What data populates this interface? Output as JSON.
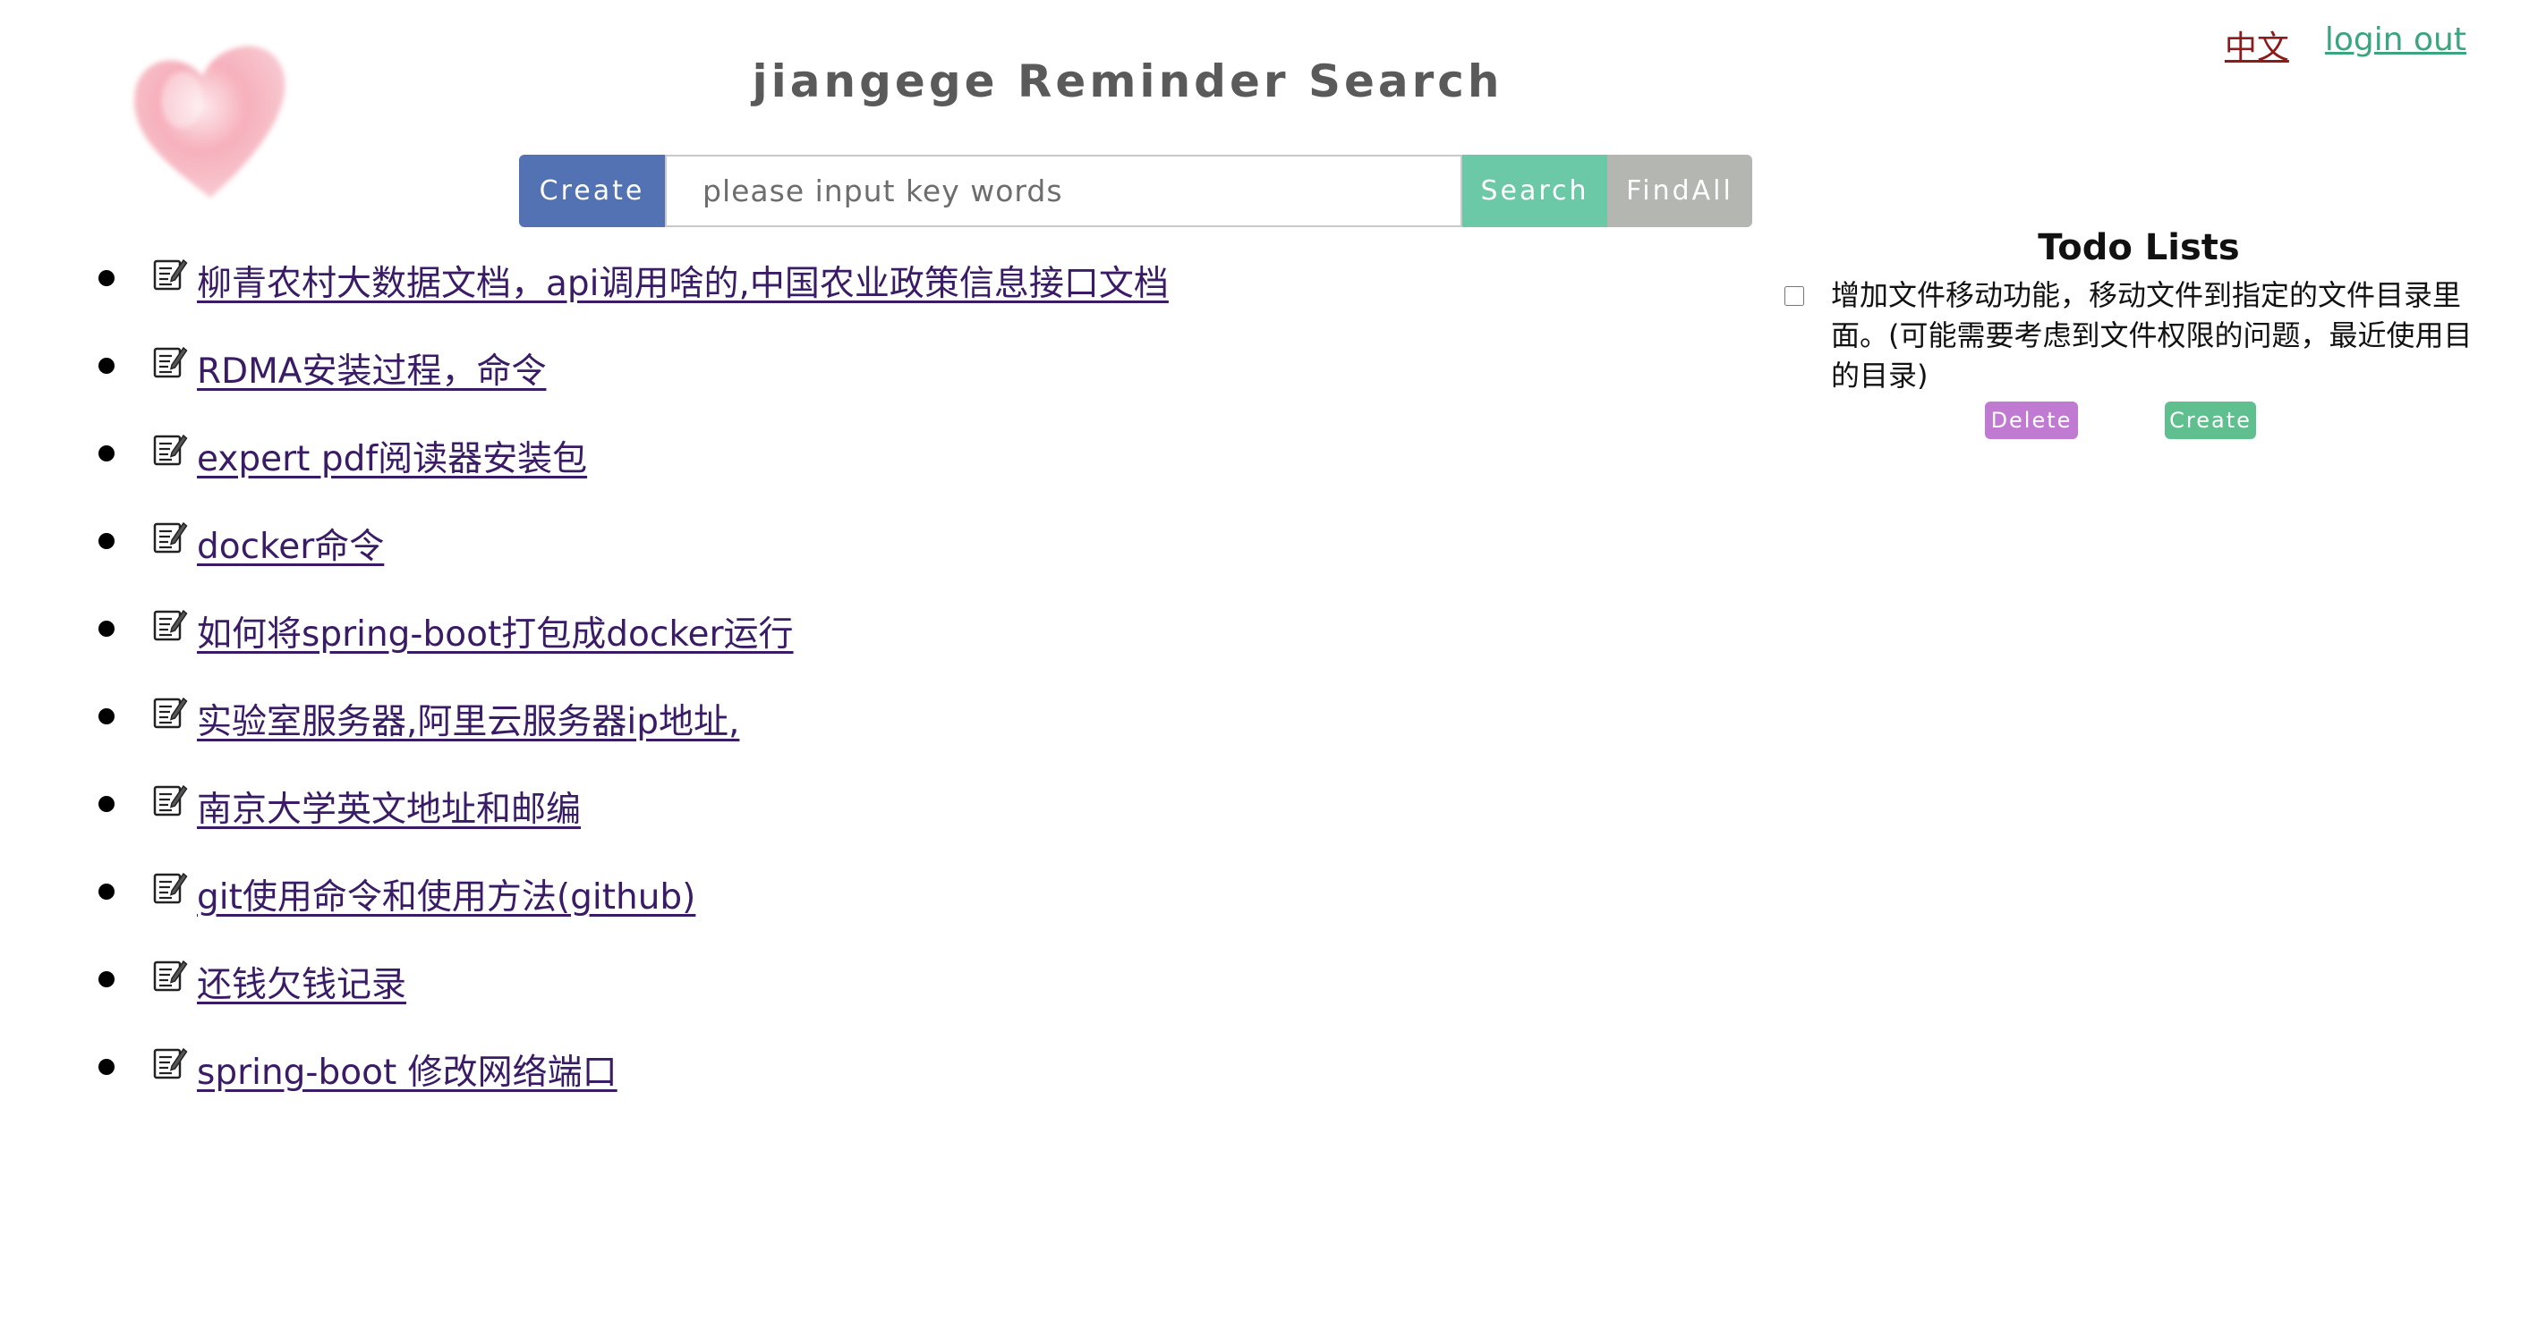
{
  "header": {
    "title": "jiangege Reminder Search",
    "lang_link": "中文",
    "logout_link": "login out"
  },
  "search": {
    "create_label": "Create",
    "placeholder": "please input key words",
    "value": "",
    "search_label": "Search",
    "findall_label": "FindAll"
  },
  "reminders": [
    {
      "title": "柳青农村大数据文档，api调用啥的,中国农业政策信息接口文档"
    },
    {
      "title": "RDMA安装过程，命令"
    },
    {
      "title": "expert pdf阅读器安装包"
    },
    {
      "title": "docker命令"
    },
    {
      "title": "如何将spring-boot打包成docker运行"
    },
    {
      "title": "实验室服务器,阿里云服务器ip地址,"
    },
    {
      "title": "南京大学英文地址和邮编"
    },
    {
      "title": "git使用命令和使用方法(github)"
    },
    {
      "title": "还钱欠钱记录"
    },
    {
      "title": "spring-boot 修改网络端口"
    }
  ],
  "todo": {
    "title": "Todo Lists",
    "items": [
      {
        "text": "增加文件移动功能，移动文件到指定的文件目录里面。(可能需要考虑到文件权限的问题，最近使用目的目录)",
        "checked": false
      }
    ],
    "delete_label": "Delete",
    "create_label": "Create"
  },
  "icons": {
    "logo": "heart-logo",
    "item_icon": "memo-icon"
  },
  "colors": {
    "create_button": "#5272b4",
    "search_button": "#6cc9a8",
    "findall_button": "#b4b6b2",
    "link": "#3a1b66",
    "lang_link": "#8b1c1c",
    "logout_link": "#3aa57e",
    "todo_delete": "#c07ad1",
    "todo_create": "#5fbf8f"
  }
}
